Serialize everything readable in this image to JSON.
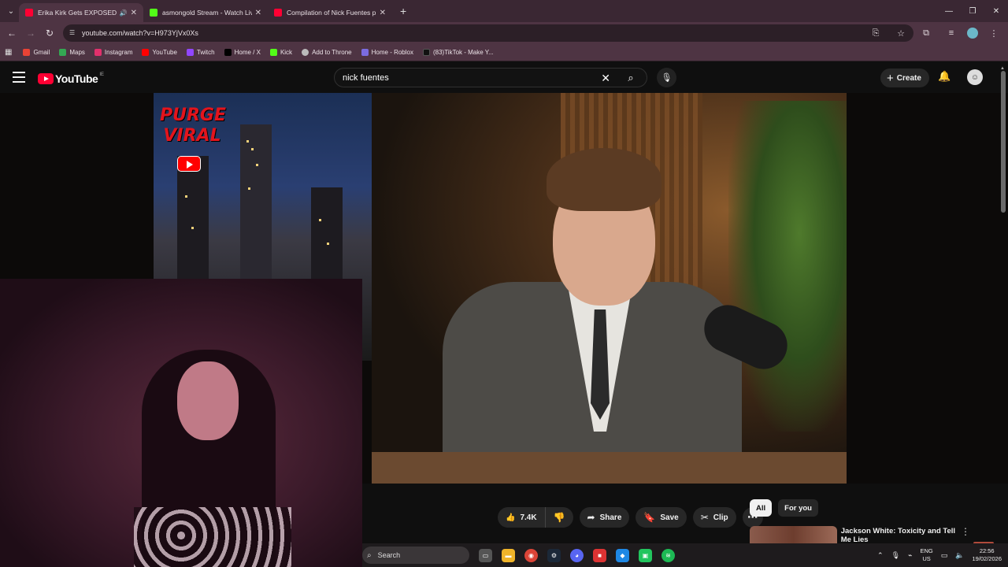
{
  "browser": {
    "tabs": [
      {
        "title": "Erika Kirk Gets EXPOSED by",
        "favicon_color": "#ff0033",
        "active": true,
        "audio": true
      },
      {
        "title": "asmongold Stream - Watch Live",
        "favicon_color": "#53fc18",
        "active": false,
        "audio": false
      },
      {
        "title": "Compilation of Nick Fuentes p",
        "favicon_color": "#ff0033",
        "active": false,
        "audio": false
      }
    ],
    "url": "youtube.com/watch?v=H973YjVx0Xs",
    "bookmarks": [
      {
        "label": "Gmail",
        "color": "#ea4335"
      },
      {
        "label": "Maps",
        "color": "#34a853"
      },
      {
        "label": "Instagram",
        "color": "#e1306c"
      },
      {
        "label": "YouTube",
        "color": "#ff0000"
      },
      {
        "label": "Twitch",
        "color": "#9146ff"
      },
      {
        "label": "Home / X",
        "color": "#000000"
      },
      {
        "label": "Kick",
        "color": "#53fc18"
      },
      {
        "label": "Add to Throne",
        "color": "#bbbbbb"
      },
      {
        "label": "Home - Roblox",
        "color": "#7b6ce0"
      },
      {
        "label": "(83)TikTok - Make Y...",
        "color": "#111111"
      }
    ]
  },
  "youtube": {
    "logo_text": "YouTube",
    "logo_country": "IE",
    "search_value": "nick fuentes",
    "create_label": "Create",
    "overlay_text": [
      "PURGE",
      "VIRAL"
    ],
    "actions": {
      "like_count": "7.4K",
      "share_label": "Share",
      "save_label": "Save",
      "clip_label": "Clip"
    },
    "chips": [
      "All",
      "For you"
    ],
    "recommendation": {
      "title": "Jackson White: Toxicity and Tell Me Lies"
    }
  },
  "taskbar": {
    "search_label": "Search",
    "lang": [
      "ENG",
      "US"
    ],
    "time": "22:56",
    "date": "19/02/2026",
    "apps": [
      {
        "name": "task-view",
        "color": "#555555"
      },
      {
        "name": "file-explorer",
        "color": "#f0b429"
      },
      {
        "name": "chrome",
        "color": "#db4437"
      },
      {
        "name": "steam",
        "color": "#1b2838"
      },
      {
        "name": "discord",
        "color": "#5865f2"
      },
      {
        "name": "red-app",
        "color": "#d33"
      },
      {
        "name": "blue-app",
        "color": "#1e88e5"
      },
      {
        "name": "green-app",
        "color": "#22c55e"
      },
      {
        "name": "spotify",
        "color": "#1db954"
      }
    ]
  }
}
